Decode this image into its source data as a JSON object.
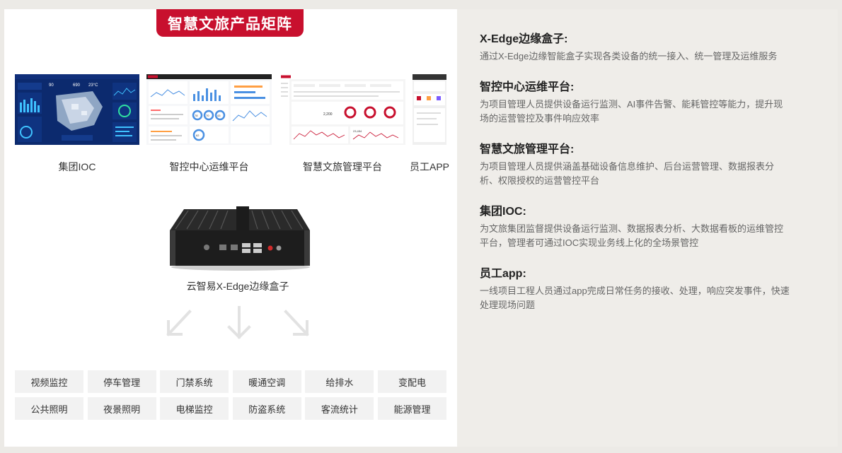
{
  "banner": {
    "title": "智慧文旅产品矩阵"
  },
  "screens": [
    {
      "label": "集团IOC",
      "kpis": [
        "90",
        "690",
        "23°C"
      ]
    },
    {
      "label": "智控中心运维平台",
      "kpis": [
        "78",
        "70",
        "43",
        "62"
      ]
    },
    {
      "label": "智慧文旅管理平台",
      "kpis": [
        "2,200",
        "23,454"
      ]
    },
    {
      "label": "员工APP"
    }
  ],
  "edge_box": {
    "caption": "云智易X-Edge边缘盒子"
  },
  "systems": [
    "视频监控",
    "停车管理",
    "门禁系统",
    "暖通空调",
    "给排水",
    "变配电",
    "公共照明",
    "夜景照明",
    "电梯监控",
    "防盗系统",
    "客流统计",
    "能源管理"
  ],
  "descriptions": [
    {
      "title": "X-Edge边缘盒子:",
      "text": [
        "通过X-Edge边缘智能盒子实现各类设备的统一接入、统一管理及运维服务"
      ]
    },
    {
      "title": "智控中心运维平台:",
      "text": [
        "为项目管理人员提供设备运行监测、AI事件告警、能耗管控等能力，提升现",
        "场的运营管控及事件响应效率"
      ]
    },
    {
      "title": "智慧文旅管理平台:",
      "text": [
        "为项目管理人员提供涵盖基础设备信息维护、后台运营管理、数据报表分",
        "析、权限授权的运营管控平台"
      ]
    },
    {
      "title": "集团IOC:",
      "text": [
        "为文旅集团监督提供设备运行监测、数据报表分析、大数据看板的运维管控",
        "平台，管理者可通过IOC实现业务线上化的全场景管控"
      ]
    },
    {
      "title": "员工app:",
      "text": [
        "一线项目工程人员通过app完成日常任务的接收、处理，响应突发事件，快速",
        "处理现场问题"
      ]
    }
  ],
  "colors": {
    "brand_red": "#c8102e",
    "ioc_bg": "#0c2a6e"
  }
}
